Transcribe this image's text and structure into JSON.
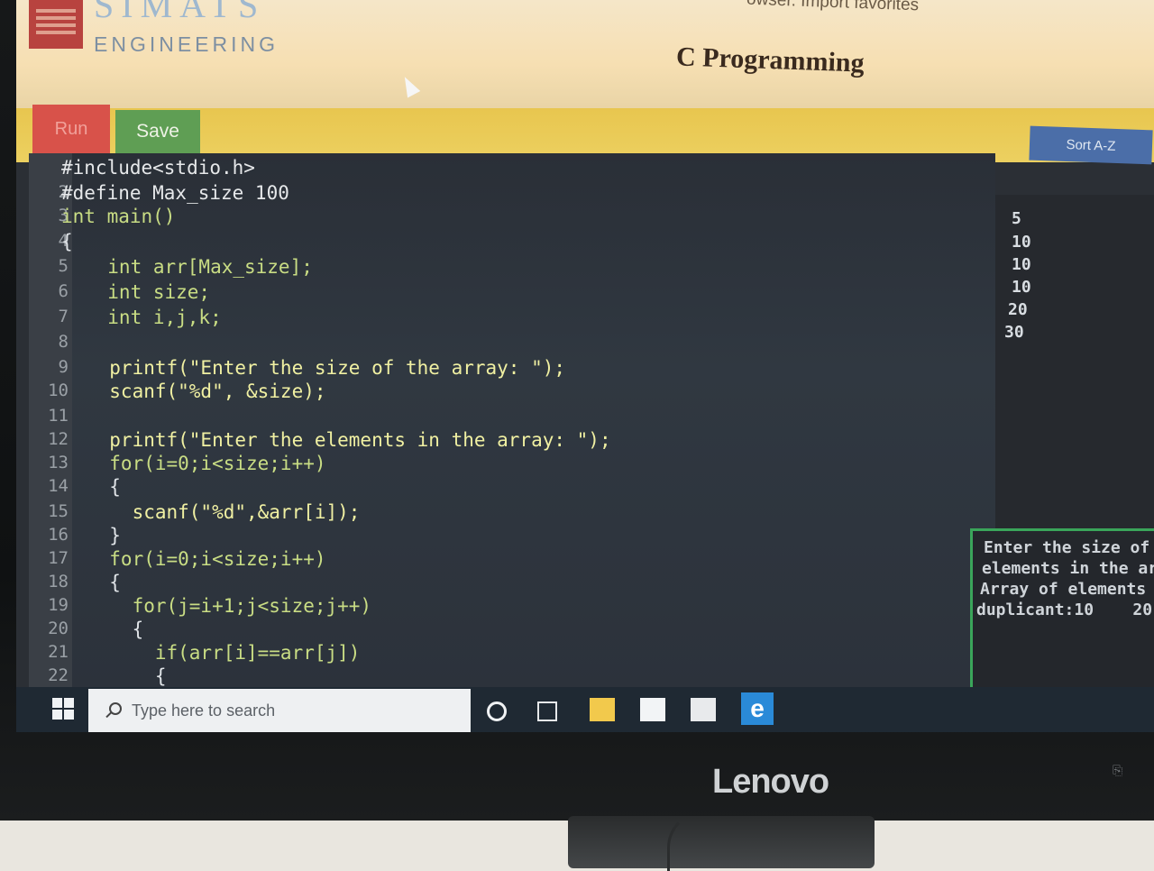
{
  "header": {
    "brand_top": "SIMATS",
    "brand_bottom": "ENGINEERING",
    "browser_message": "owser. Import favorites",
    "page_title": "C Programming"
  },
  "toolbar": {
    "run_label": "Run",
    "save_label": "Save",
    "sort_label": "Sort A-Z"
  },
  "editor": {
    "lines": [
      {
        "n": "",
        "code": "#include<stdio.h>"
      },
      {
        "n": "2",
        "code": "#define Max_size 100"
      },
      {
        "n": "3",
        "code": "int main()"
      },
      {
        "n": "4",
        "code": "{"
      },
      {
        "n": "5",
        "code": "  int arr[Max_size];"
      },
      {
        "n": "6",
        "code": "  int size;"
      },
      {
        "n": "7",
        "code": "  int i,j,k;"
      },
      {
        "n": "8",
        "code": ""
      },
      {
        "n": "9",
        "code": "  printf(\"Enter the size of the array: \");"
      },
      {
        "n": "10",
        "code": "  scanf(\"%d\", &size);"
      },
      {
        "n": "11",
        "code": ""
      },
      {
        "n": "12",
        "code": "  printf(\"Enter the elements in the array: \");"
      },
      {
        "n": "13",
        "code": "  for(i=0;i<size;i++)"
      },
      {
        "n": "14",
        "code": "  {"
      },
      {
        "n": "15",
        "code": "    scanf(\"%d\",&arr[i]);"
      },
      {
        "n": "16",
        "code": "  }"
      },
      {
        "n": "17",
        "code": "  for(i=0;i<size;i++)"
      },
      {
        "n": "18",
        "code": "  {"
      },
      {
        "n": "19",
        "code": "    for(j=i+1;j<size;j++)"
      },
      {
        "n": "20",
        "code": "    {"
      },
      {
        "n": "21",
        "code": "      if(arr[i]==arr[j])"
      },
      {
        "n": "22",
        "code": "      {"
      }
    ]
  },
  "input_pane": {
    "values": [
      "5",
      "10",
      "10",
      "10",
      "20",
      "30"
    ]
  },
  "console": {
    "lines": [
      "Enter the size of t",
      "elements in the arr",
      "Array of elements a",
      "duplicant:10    20"
    ]
  },
  "taskbar": {
    "search_placeholder": "Type here to search",
    "edge_glyph": "e"
  },
  "monitor": {
    "brand": "Lenovo"
  }
}
